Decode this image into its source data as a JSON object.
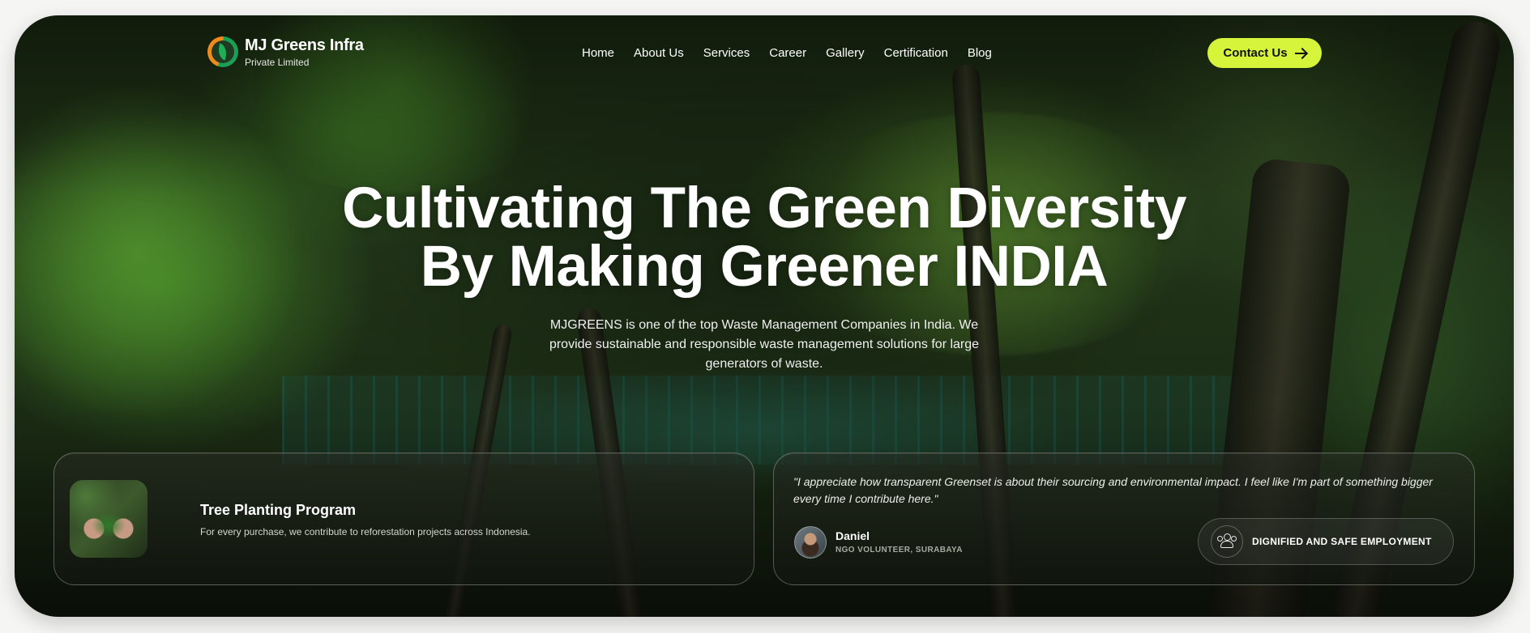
{
  "brand": {
    "name": "MJ Greens Infra",
    "subtitle": "Private Limited"
  },
  "nav": {
    "items": [
      "Home",
      "About Us",
      "Services",
      "Career",
      "Gallery",
      "Certification",
      "Blog"
    ]
  },
  "cta": {
    "label": "Contact Us",
    "icon": "arrow-right-icon",
    "color": "#d6f53a"
  },
  "hero": {
    "headline_line1": "Cultivating The Green Diversity",
    "headline_line2": "By Making Greener INDIA",
    "description": "MJGREENS is one of the top Waste Management Companies in India. We provide sustainable and responsible waste management solutions for large generators of waste."
  },
  "program_card": {
    "title": "Tree Planting Program",
    "description": "For every purchase, we contribute to reforestation projects across Indonesia."
  },
  "testimonial": {
    "quote": "\"I appreciate how transparent Greenset is about their sourcing and environmental impact. I feel like I'm part of something bigger every time I contribute here.\"",
    "name": "Daniel",
    "role": "NGO VOLUNTEER, SURABAYA",
    "badge_label": "DIGNIFIED AND SAFE EMPLOYMENT",
    "badge_icon": "people-group-icon"
  }
}
